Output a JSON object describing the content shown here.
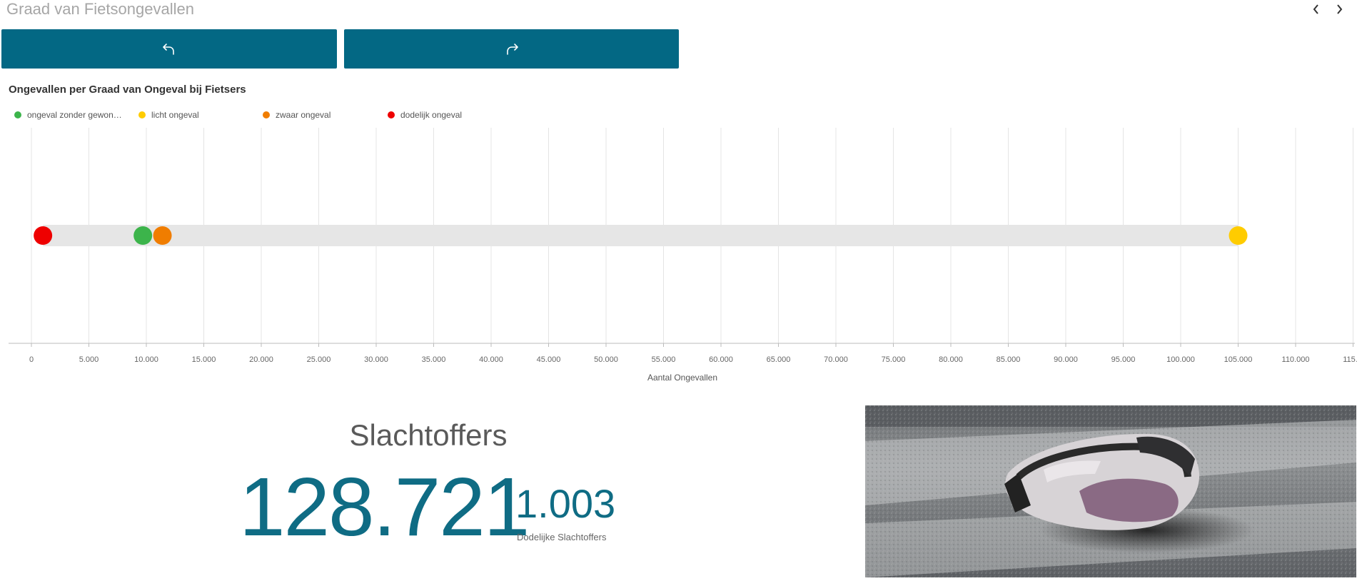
{
  "page": {
    "title": "Graad van Fietsongevallen"
  },
  "nav": {
    "prev_icon": "chevron-left-icon",
    "next_icon": "chevron-right-icon"
  },
  "toolbar": {
    "undo_icon": "undo-arrow-icon",
    "redo_icon": "redo-arrow-icon",
    "button_color": "#036884"
  },
  "chart_data": {
    "type": "scatter",
    "title": "Ongevallen per Graad van Ongeval bij Fietsers",
    "xlabel": "Aantal Ongevallen",
    "xlim": [
      -2000,
      115000
    ],
    "x_ticks": [
      0,
      5000,
      10000,
      15000,
      20000,
      25000,
      30000,
      35000,
      40000,
      45000,
      50000,
      55000,
      60000,
      65000,
      70000,
      75000,
      80000,
      85000,
      90000,
      95000,
      100000,
      105000,
      110000,
      115000
    ],
    "x_tick_labels": [
      "0",
      "5.000",
      "10.000",
      "15.000",
      "20.000",
      "25.000",
      "30.000",
      "35.000",
      "40.000",
      "45.000",
      "50.000",
      "55.000",
      "60.000",
      "65.000",
      "70.000",
      "75.000",
      "80.000",
      "85.000",
      "90.000",
      "95.000",
      "100.000",
      "105.000",
      "110.000",
      "115…"
    ],
    "range_bar": {
      "from": 1003,
      "to": 105000,
      "color": "#e6e6e6"
    },
    "grid": true,
    "legend_position": "top-left",
    "series": [
      {
        "name": "ongeval zonder gewon…",
        "value": 9700,
        "color": "#3cb44b"
      },
      {
        "name": "licht ongeval",
        "value": 105000,
        "color": "#ffcc00"
      },
      {
        "name": "zwaar ongeval",
        "value": 11400,
        "color": "#f07d00"
      },
      {
        "name": "dodelijk ongeval",
        "value": 1003,
        "color": "#ee0000"
      }
    ]
  },
  "kpi": {
    "title": "Slachtoffers",
    "main_value": "128.721",
    "secondary_value": "1.003",
    "secondary_label": "Dodelijke Slachtoffers",
    "color": "#0f6c84"
  },
  "photo": {
    "subject": "bicycle-helmet-photo"
  }
}
